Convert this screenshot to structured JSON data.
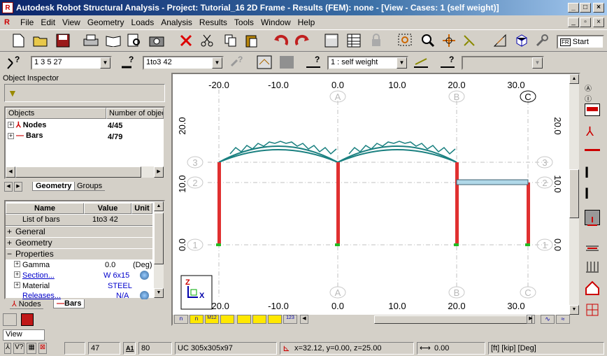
{
  "window": {
    "title": "Autodesk Robot Structural Analysis - Project: Tutorial_16 2D Frame - Results (FEM): none - [View - Cases: 1 (self weight)]",
    "app_icon": "R"
  },
  "menu": [
    "File",
    "Edit",
    "View",
    "Geometry",
    "Loads",
    "Analysis",
    "Results",
    "Tools",
    "Window",
    "Help"
  ],
  "toolbar": {
    "start_label": "Start",
    "start_icon_text": "FR"
  },
  "selection": {
    "nodes_value": "1 3 5 27",
    "bars_value": "1to3 42",
    "case_value": "1 : self weight"
  },
  "inspector": {
    "title": "Object Inspector",
    "col_objects": "Objects",
    "col_number": "Number of objec",
    "rows": [
      {
        "name": "Nodes",
        "count": "4/45"
      },
      {
        "name": "Bars",
        "count": "4/79"
      }
    ],
    "tabs": [
      "Geometry",
      "Groups"
    ]
  },
  "properties": {
    "col_name": "Name",
    "col_value": "Value",
    "col_unit": "Unit",
    "list_label": "List of bars",
    "list_value": "1to3 42",
    "groups": [
      "General",
      "Geometry",
      "Properties"
    ],
    "items": [
      {
        "name": "Gamma",
        "value": "0.0",
        "unit": "(Deg)"
      },
      {
        "name": "Section...",
        "value": "W 6x15",
        "unit": ""
      },
      {
        "name": "Material",
        "value": "STEEL",
        "unit": ""
      },
      {
        "name": "Releases...",
        "value": "N/A",
        "unit": ""
      }
    ],
    "tabs": [
      "Nodes",
      "Bars"
    ]
  },
  "view": {
    "x_ticks": [
      "-20.0",
      "-10.0",
      "0.0",
      "10.0",
      "20.0",
      "30.0"
    ],
    "y_ticks": [
      "20.0",
      "10.0",
      "0.0"
    ],
    "col_axes": [
      "A",
      "B",
      "C"
    ],
    "row_axes": [
      "3",
      "2",
      "1"
    ],
    "bottom_tabs": [
      "n",
      "n",
      "M12",
      "",
      "",
      "",
      "",
      "123"
    ],
    "colors": {
      "arch": "#1a8080",
      "column": "#e03030",
      "beam": "#b0d8e8",
      "support": "#22bb22",
      "grid": "#c0c0c0"
    }
  },
  "bottom_view_label": "View",
  "status": {
    "f1": "47",
    "f2_icon": "A1",
    "f2": "80",
    "section": "UC 305x305x97",
    "coords": "x=32.12, y=0.00, z=25.00",
    "angle": "0.00",
    "units": "[ft] [kip] [Deg]"
  }
}
